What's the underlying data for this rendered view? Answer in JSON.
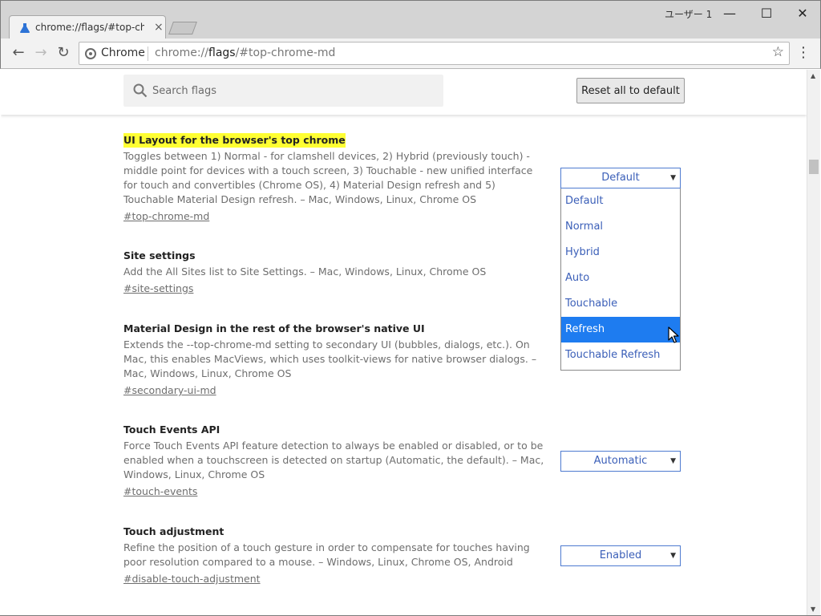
{
  "window": {
    "profile": "ユーザー 1",
    "minimize": "—",
    "maximize": "☐",
    "close": "✕"
  },
  "tab": {
    "title": "chrome://flags/#top-chrome-md",
    "close": "×"
  },
  "toolbar": {
    "back": "←",
    "forward": "→",
    "reload": "↻",
    "site_label": "Chrome",
    "url_prefix": "chrome://",
    "url_host": "flags",
    "url_path": "/#top-chrome-md",
    "bookmark": "☆",
    "menu": "⋮"
  },
  "search": {
    "placeholder": "Search flags",
    "value": ""
  },
  "reset_label": "Reset all to default",
  "flags": [
    {
      "title": "UI Layout for the browser's top chrome",
      "description": "Toggles between 1) Normal - for clamshell devices, 2) Hybrid (previously touch) - middle point for devices with a touch screen, 3) Touchable - new unified interface for touch and convertibles (Chrome OS), 4) Material Design refresh and 5) Touchable Material Design refresh. – Mac, Windows, Linux, Chrome OS",
      "link": "#top-chrome-md",
      "value": "Default"
    },
    {
      "title": "Site settings",
      "description": "Add the All Sites list to Site Settings. – Mac, Windows, Linux, Chrome OS",
      "link": "#site-settings",
      "value": ""
    },
    {
      "title": "Material Design in the rest of the browser's native UI",
      "description": "Extends the --top-chrome-md setting to secondary UI (bubbles, dialogs, etc.). On Mac, this enables MacViews, which uses toolkit-views for native browser dialogs. – Mac, Windows, Linux, Chrome OS",
      "link": "#secondary-ui-md",
      "value": ""
    },
    {
      "title": "Touch Events API",
      "description": "Force Touch Events API feature detection to always be enabled or disabled, or to be enabled when a touchscreen is detected on startup (Automatic, the default). – Mac, Windows, Linux, Chrome OS",
      "link": "#touch-events",
      "value": "Automatic"
    },
    {
      "title": "Touch adjustment",
      "description": "Refine the position of a touch gesture in order to compensate for touches having poor resolution compared to a mouse. – Windows, Linux, Chrome OS, Android",
      "link": "#disable-touch-adjustment",
      "value": "Enabled"
    }
  ],
  "dropdown_options": [
    "Default",
    "Normal",
    "Hybrid",
    "Auto",
    "Touchable",
    "Refresh",
    "Touchable Refresh"
  ],
  "dropdown_highlighted": "Refresh",
  "colors": {
    "highlight": "#ffff33",
    "select_text": "#3b5fb8",
    "selected_option": "#1e7cf0"
  }
}
